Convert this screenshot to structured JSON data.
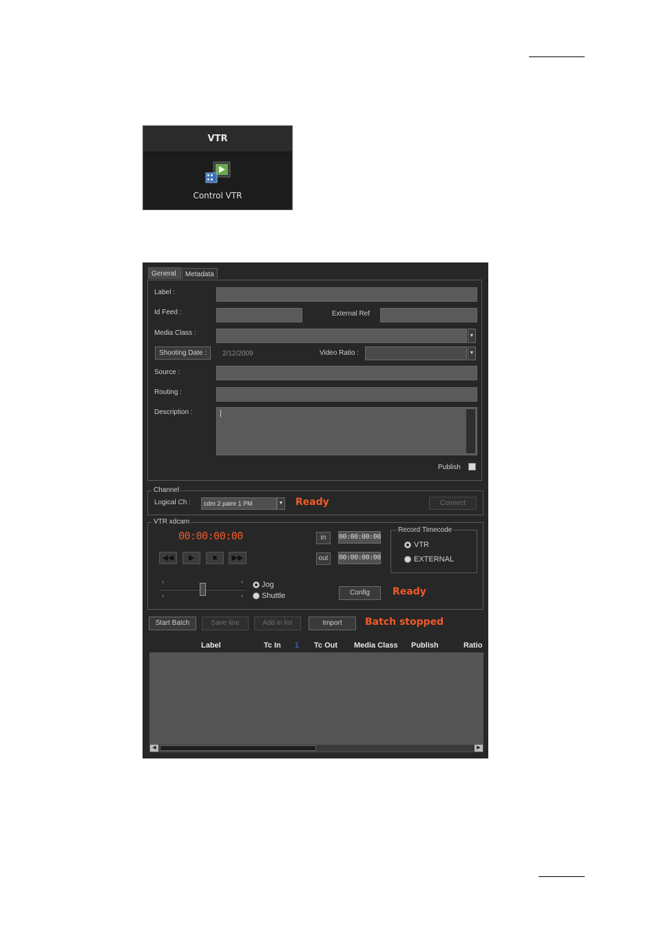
{
  "vtr_panel": {
    "title": "VTR",
    "control_label": "Control VTR"
  },
  "tabs": [
    {
      "label": "General",
      "active": true
    },
    {
      "label": "Metadata",
      "active": false
    }
  ],
  "general": {
    "label_lbl": "Label :",
    "label_value": "",
    "id_feed_lbl": "Id Feed :",
    "id_feed_value": "",
    "external_ref_lbl": "External Ref",
    "external_ref_value": "",
    "media_class_lbl": "Media Class :",
    "media_class_value": "",
    "shooting_date_btn": "Shooting Date :",
    "shooting_date_value": "2/12/2009",
    "video_ratio_lbl": "Video Ratio :",
    "video_ratio_value": "",
    "source_lbl": "Source :",
    "source_value": "",
    "routing_lbl": "Routing :",
    "routing_value": "",
    "description_lbl": "Description :",
    "description_value": "|",
    "publish_lbl": "Publish",
    "publish_checked": false
  },
  "channel": {
    "group_title": "Channel",
    "logical_ch_lbl": "Logical Ch :",
    "logical_ch_value": "cdm 2 paire 1 PM",
    "status": "Ready",
    "connect_btn": "Connect"
  },
  "vtr": {
    "group_title": "VTR xdcam",
    "timecode": "00:00:00:00",
    "in_btn": "in",
    "in_value": "00:00:00:00",
    "out_btn": "out",
    "out_value": "00:00:00:00",
    "record_timecode_title": "Record Timecode",
    "rtc_options": [
      "VTR",
      "EXTERNAL"
    ],
    "rtc_selected": "VTR",
    "jog_lbl": "Jog",
    "shuttle_lbl": "Shuttle",
    "mode_selected": "Jog",
    "config_btn": "Config",
    "status": "Ready",
    "transport_icons": [
      "rewind-icon",
      "play-icon",
      "stop-icon",
      "fast-forward-icon"
    ]
  },
  "batch": {
    "start_btn": "Start Batch",
    "save_btn": "Save line",
    "add_btn": "Add in list",
    "import_btn": "Import",
    "status": "Batch stopped",
    "columns": [
      "Label",
      "Tc In",
      "1",
      "Tc Out",
      "Media Class",
      "Publish",
      "Ratio"
    ],
    "rows": []
  },
  "colors": {
    "status_orange": "#f05a28",
    "window_bg": "#272727",
    "field_bg": "#5a5a5a",
    "sort_indicator": "#3a7bff"
  }
}
